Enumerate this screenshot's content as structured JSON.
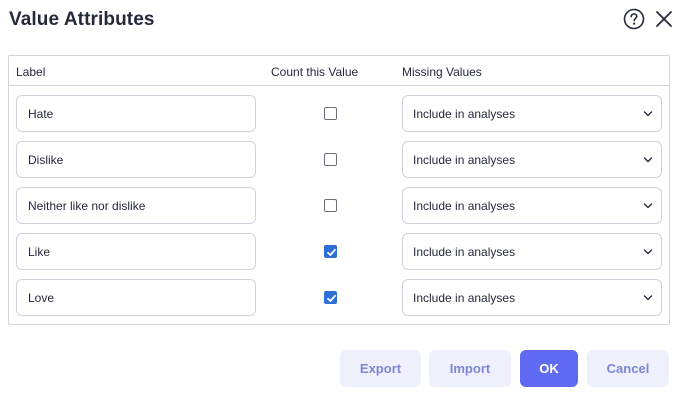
{
  "dialog": {
    "title": "Value Attributes",
    "help_icon": "help-icon",
    "close_icon": "close-icon"
  },
  "table": {
    "headers": {
      "label": "Label",
      "count": "Count this Value",
      "missing": "Missing Values"
    },
    "rows": [
      {
        "label": "Hate",
        "counted": false,
        "missing": "Include in analyses"
      },
      {
        "label": "Dislike",
        "counted": false,
        "missing": "Include in analyses"
      },
      {
        "label": "Neither like nor dislike",
        "counted": false,
        "missing": "Include in analyses"
      },
      {
        "label": "Like",
        "counted": true,
        "missing": "Include in analyses"
      },
      {
        "label": "Love",
        "counted": true,
        "missing": "Include in analyses"
      }
    ]
  },
  "buttons": {
    "export": "Export",
    "import": "Import",
    "ok": "OK",
    "cancel": "Cancel"
  },
  "colors": {
    "accent": "#5f69f2",
    "checkbox_checked": "#2d6fd6",
    "secondary_button_bg": "#eef0fb",
    "secondary_button_text": "#7f86d4"
  }
}
